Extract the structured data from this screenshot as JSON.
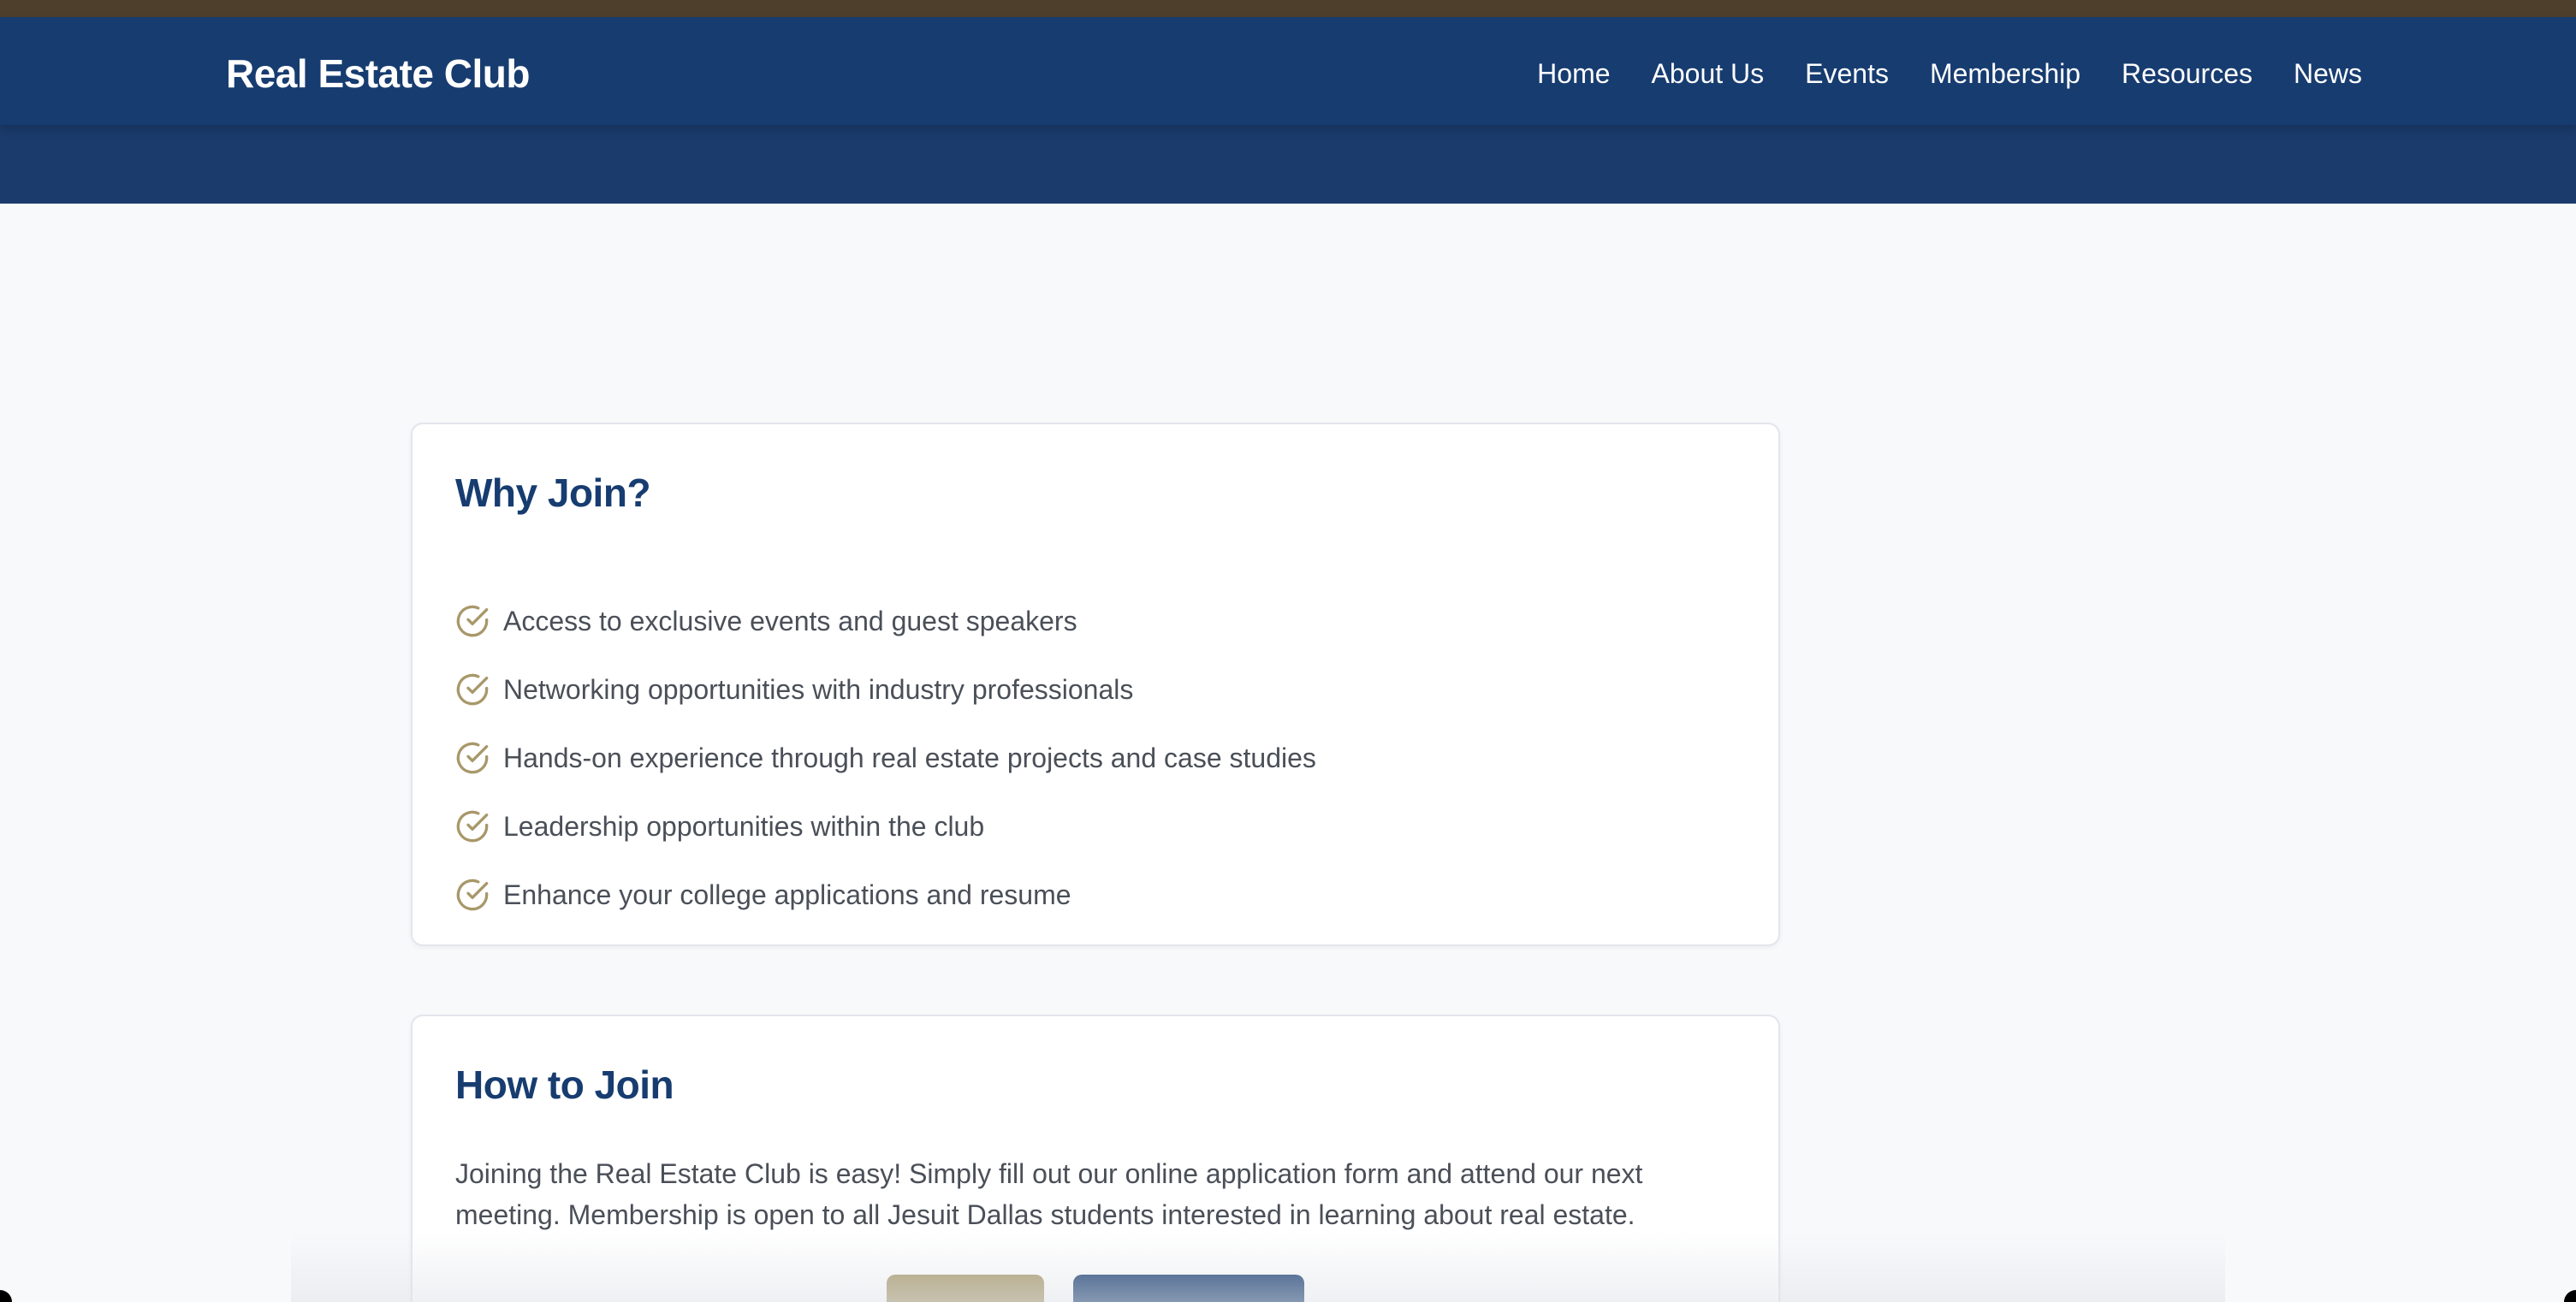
{
  "header": {
    "brand": "Real Estate Club",
    "nav": [
      {
        "label": "Home"
      },
      {
        "label": "About Us"
      },
      {
        "label": "Events"
      },
      {
        "label": "Membership"
      },
      {
        "label": "Resources"
      },
      {
        "label": "News"
      }
    ]
  },
  "why_join": {
    "title": "Why Join?",
    "benefits": [
      "Access to exclusive events and guest speakers",
      "Networking opportunities with industry professionals",
      "Hands-on experience through real estate projects and case studies",
      "Leadership opportunities within the club",
      "Enhance your college applications and resume"
    ],
    "icon": "check-circle-icon"
  },
  "how_to_join": {
    "title": "How to Join",
    "body": "Joining the Real Estate Club is easy! Simply fill out our online application form and attend our next meeting. Membership is open to all Jesuit Dallas students interested in learning about real estate."
  },
  "colors": {
    "navy": "#173c70",
    "gold": "#a8986a",
    "top_strip": "#4e3f2d",
    "text": "#4a4f58",
    "background": "#f8f9fb"
  }
}
